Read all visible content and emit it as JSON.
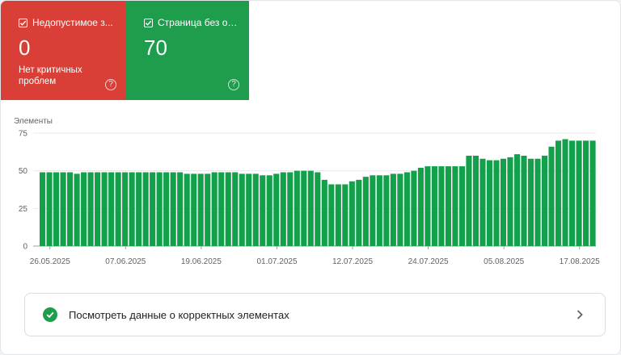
{
  "colors": {
    "red": "#d93f36",
    "green": "#1e9e4d",
    "bar": "#13a04a",
    "grid": "#e8eaed",
    "axis": "#5f6368"
  },
  "cards": [
    {
      "title": "Недопустимое з...",
      "value": "0",
      "subtitle": "Нет критичных проблем",
      "help": "?"
    },
    {
      "title": "Страница без ош...",
      "value": "70",
      "subtitle": "",
      "help": "?"
    }
  ],
  "chart_data": {
    "type": "bar",
    "ylabel": "Элементы",
    "ylim": [
      0,
      75
    ],
    "yticks": [
      0,
      25,
      50,
      75
    ],
    "xtick_labels": [
      "26.05.2025",
      "07.06.2025",
      "19.06.2025",
      "01.07.2025",
      "12.07.2025",
      "24.07.2025",
      "05.08.2025",
      "17.08.2025"
    ],
    "start_date": "26.05.2025",
    "values": [
      49,
      49,
      49,
      49,
      49,
      48,
      49,
      49,
      49,
      49,
      49,
      49,
      49,
      49,
      49,
      49,
      49,
      49,
      49,
      49,
      49,
      48,
      48,
      48,
      48,
      49,
      49,
      49,
      49,
      48,
      48,
      48,
      47,
      47,
      48,
      49,
      49,
      50,
      50,
      50,
      49,
      44,
      41,
      41,
      41,
      43,
      44,
      46,
      47,
      47,
      47,
      48,
      48,
      49,
      50,
      52,
      53,
      53,
      53,
      53,
      53,
      53,
      60,
      60,
      58,
      57,
      57,
      58,
      59,
      61,
      60,
      58,
      58,
      60,
      66,
      70,
      71,
      70,
      70,
      70,
      70
    ]
  },
  "details_link": {
    "label": "Посмотреть данные о корректных элементах"
  }
}
